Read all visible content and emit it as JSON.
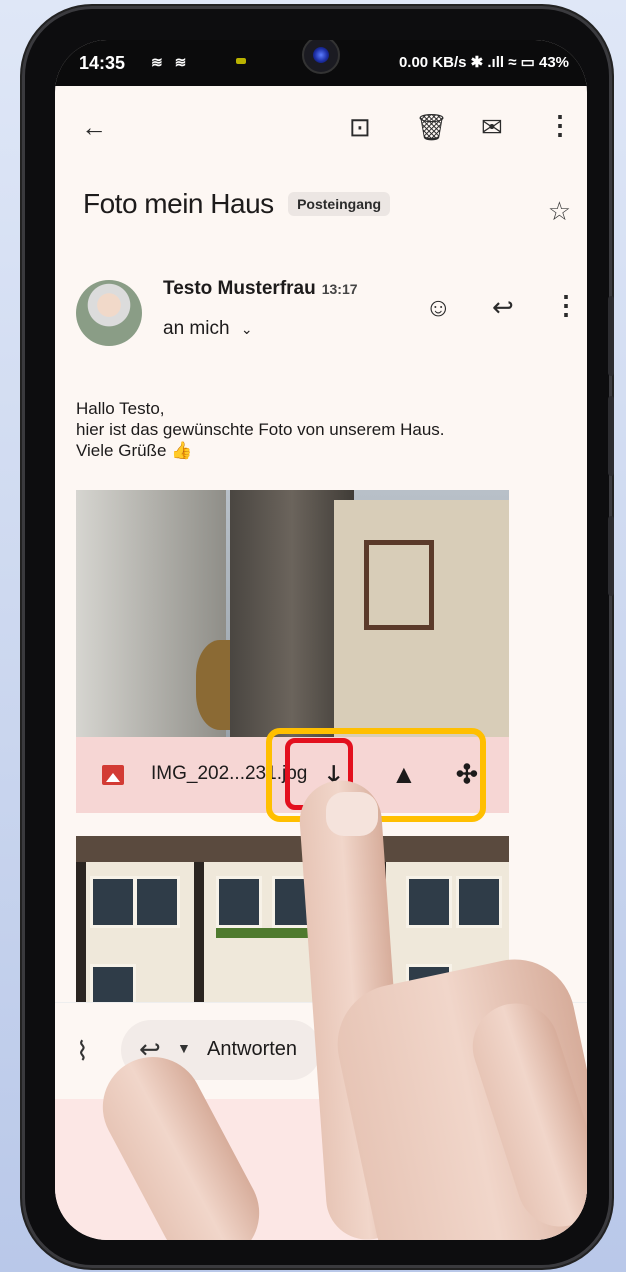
{
  "status_bar": {
    "time": "14:35",
    "left_icons": "≋ ≋",
    "right_text": "0.00 KB/s ✱ .ıll ≈ ▭ 43%"
  },
  "appbar": {
    "back_icon": "arrow-left-icon",
    "archive_icon": "archive-icon",
    "delete_icon": "trash-icon",
    "mark_unread_icon": "mail-unread-icon",
    "more_icon": "more-vert-icon"
  },
  "email": {
    "subject": "Foto mein Haus",
    "label": "Posteingang",
    "sender": "Testo Musterfrau",
    "time": "13:17",
    "recipient": "an mich",
    "body_line1": "Hallo Testo,",
    "body_line2": "hier ist das gewünschte Foto von unserem Haus.",
    "body_line3": "Viele Grüße 👍"
  },
  "attachment": {
    "file_name": "IMG_202...231.jpg"
  },
  "reply_bar": {
    "reply_label": "Antworten"
  }
}
